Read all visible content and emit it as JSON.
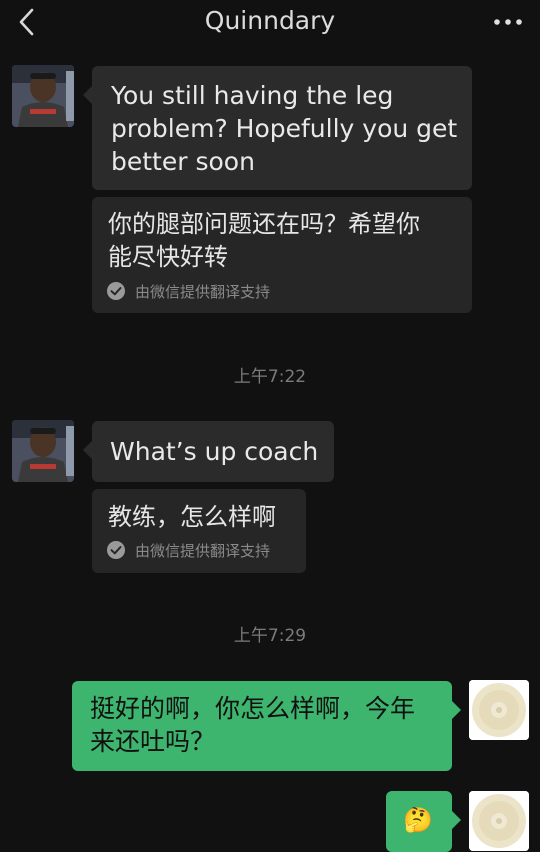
{
  "header": {
    "title": "Quinndary",
    "back_icon": "chevron-left-icon",
    "more_icon": "more-dots-icon"
  },
  "messages": [
    {
      "original": [
        "You still having the leg",
        "problem? Hopefully you get",
        "better soon"
      ],
      "translation": [
        "你的腿部问题还在吗？希望你",
        "能尽快好转"
      ],
      "translation_note": "由微信提供翻译支持"
    },
    {
      "original": "What’s up coach",
      "translation": "教练，怎么样啊",
      "translation_note": "由微信提供翻译支持"
    }
  ],
  "timestamps": [
    "上午7:22",
    "上午7:29"
  ],
  "outgoing": [
    {
      "text": [
        "挺好的啊，你怎么样啊，今年",
        "来还吐吗？"
      ]
    },
    {
      "emoji": "🤔",
      "emoji_name": "thinking-face-emoji"
    }
  ],
  "colors": {
    "background": "#111111",
    "incoming_bubble": "#2b2b2b",
    "outgoing_bubble": "#3db56e"
  }
}
